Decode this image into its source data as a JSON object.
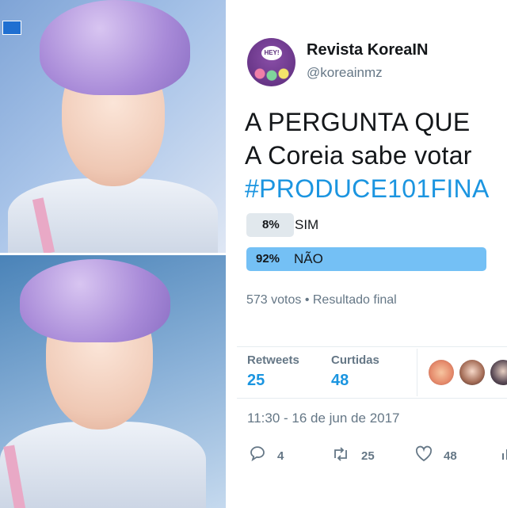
{
  "photos": {
    "top_overlay": "",
    "bottom_overlay": ""
  },
  "account": {
    "display_name": "Revista KoreaIN",
    "handle": "@koreainmz",
    "avatar_text": "HEY!"
  },
  "tweet": {
    "lines": [
      "A PERGUNTA QUE",
      "A Coreia sabe votar",
      "#PRODUCE101FINA"
    ],
    "hashtag_color": "#1b95e0"
  },
  "poll": {
    "options": [
      {
        "percent": "8%",
        "label": "SIM",
        "fraction": 0.08,
        "color": "#e1e8ed"
      },
      {
        "percent": "92%",
        "label": "NÃO",
        "fraction": 0.92,
        "color": "#74c0f5"
      }
    ],
    "meta": "573 votos • Resultado final"
  },
  "stats": {
    "retweets_label": "Retweets",
    "retweets_value": "25",
    "likes_label": "Curtidas",
    "likes_value": "48"
  },
  "timestamp": "11:30 - 16 de jun de 2017",
  "actions": {
    "reply_count": "4",
    "retweet_count": "25",
    "like_count": "48"
  },
  "colors": {
    "accent": "#1b95e0",
    "muted": "#657786",
    "text": "#14171a"
  }
}
